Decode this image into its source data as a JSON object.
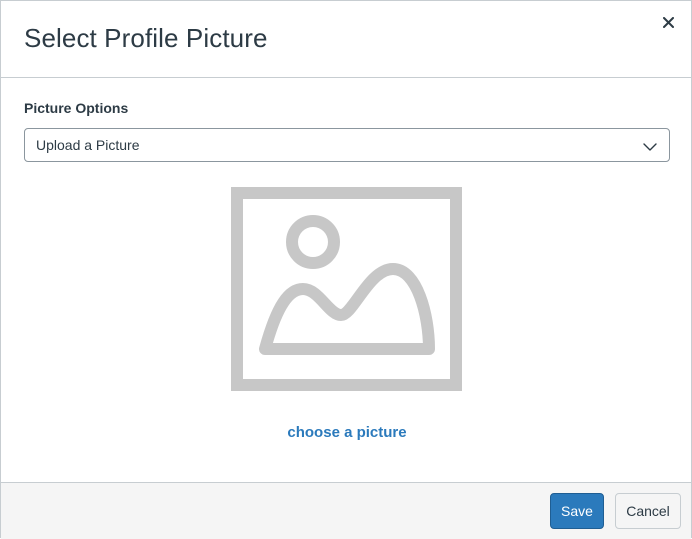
{
  "dialog": {
    "title": "Select Profile Picture",
    "close_icon": "close-icon"
  },
  "picture_options": {
    "label": "Picture Options",
    "selected": "Upload a Picture",
    "chevron_icon": "chevron-down-icon"
  },
  "preview": {
    "icon": "image-placeholder-icon",
    "choose_link": "choose a picture"
  },
  "footer": {
    "save_label": "Save",
    "cancel_label": "Cancel"
  },
  "colors": {
    "primary": "#2b7abc",
    "text": "#2d3b45",
    "border": "#c7cdd1",
    "placeholder_gray": "#c7c7c7",
    "footer_bg": "#f5f5f5"
  }
}
